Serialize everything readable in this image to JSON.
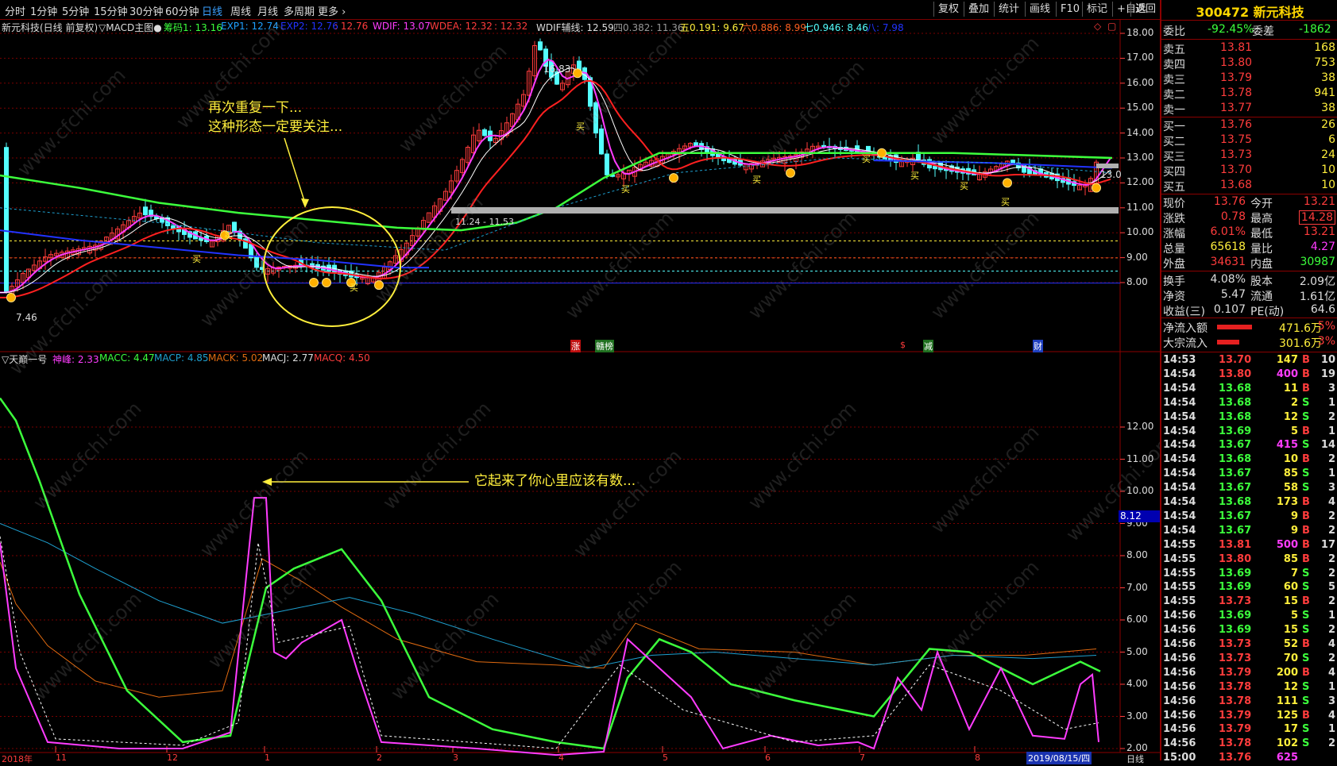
{
  "top_tabs": [
    "分时",
    "1分钟",
    "5分钟",
    "15分钟",
    "30分钟",
    "60分钟",
    "日线",
    "周线",
    "月线",
    "多周期",
    "更多"
  ],
  "active_tab": "日线",
  "toolbar_buttons": [
    "复权",
    "叠加",
    "统计",
    "画线",
    "F10",
    "标记",
    "+自选",
    "返回"
  ],
  "main_info": {
    "name": "新元科技(日线 前复权)",
    "indicator": "▽MACD主图●",
    "chouma": "筹码1: 13.16",
    "exp1": "EXP1: 12.74",
    "exp2": "EXP2: 12.76",
    "v1": ": 12.76",
    "wdif": "WDIF: 13.07",
    "wdea": "WDEA: 12.32",
    "v2": ": 12.32",
    "wdifaux": "WDIF辅线: 12.59",
    "s4": "四0.382: 11.36",
    "s5": "五0.191: 9.67",
    "s6": "六0.886: 8.99",
    "s7": "七0.946: 8.46",
    "s8": "八: 7.98"
  },
  "price_axis": [
    "18.00",
    "17.00",
    "16.00",
    "15.00",
    "14.00",
    "13.00",
    "12.00",
    "11.00",
    "10.00",
    "9.00",
    "8.00"
  ],
  "price_labels": {
    "low": "7.46",
    "high": "16.83",
    "range": "11.24 - 11.53",
    "right": "13.0"
  },
  "buy_marks": [
    "买",
    "买",
    "买",
    "买",
    "买",
    "买",
    "买",
    "买",
    "买",
    "买"
  ],
  "event_marks": [
    "涨",
    "赣榜",
    "$",
    "减",
    "财"
  ],
  "ann1": [
    "再次重复一下...",
    "这种形态一定要关注..."
  ],
  "ann2": "它起来了你心里应该有数...",
  "ind_info": {
    "name": "▽天巅一号",
    "shenfeng": "神峰: 2.33",
    "macc": "MACC: 4.47",
    "macp": "MACP: 4.85",
    "mack": "MACK: 5.02",
    "macj": "MACJ: 2.77",
    "macq": "MACQ: 4.50"
  },
  "ind_axis": [
    "12.00",
    "11.00",
    "10.00",
    "9.00",
    "8.00",
    "7.00",
    "6.00",
    "5.00",
    "4.00",
    "3.00",
    "2.00"
  ],
  "ind_current": "8.12",
  "x_axis": [
    "2018年",
    "11",
    "12",
    "1",
    "2",
    "3",
    "4",
    "5",
    "6",
    "7",
    "8"
  ],
  "x_date": "2019/08/15/四",
  "x_period": "日线",
  "watermark": "www.cfchi.com",
  "quote": {
    "code_name": "300472 新元科技",
    "weibi_label": "委比",
    "weibi": "-92.45%",
    "weicha_label": "委差",
    "weicha": "-1862",
    "sells": [
      {
        "l": "卖五",
        "p": "13.81",
        "v": "168"
      },
      {
        "l": "卖四",
        "p": "13.80",
        "v": "753"
      },
      {
        "l": "卖三",
        "p": "13.79",
        "v": "38"
      },
      {
        "l": "卖二",
        "p": "13.78",
        "v": "941"
      },
      {
        "l": "卖一",
        "p": "13.77",
        "v": "38"
      }
    ],
    "buys": [
      {
        "l": "买一",
        "p": "13.76",
        "v": "26"
      },
      {
        "l": "买二",
        "p": "13.75",
        "v": "6"
      },
      {
        "l": "买三",
        "p": "13.73",
        "v": "24"
      },
      {
        "l": "买四",
        "p": "13.70",
        "v": "10"
      },
      {
        "l": "买五",
        "p": "13.68",
        "v": "10"
      }
    ],
    "stats": [
      {
        "a": "现价",
        "av": "13.76",
        "b": "今开",
        "bv": "13.21"
      },
      {
        "a": "涨跌",
        "av": "0.78",
        "b": "最高",
        "bv": "14.28"
      },
      {
        "a": "涨幅",
        "av": "6.01%",
        "b": "最低",
        "bv": "13.21"
      },
      {
        "a": "总量",
        "av": "65618",
        "b": "量比",
        "bv": "4.27"
      },
      {
        "a": "外盘",
        "av": "34631",
        "b": "内盘",
        "bv": "30987"
      }
    ],
    "stats2": [
      {
        "a": "换手",
        "av": "4.08%",
        "b": "股本",
        "bv": "2.09亿"
      },
      {
        "a": "净资",
        "av": "5.47",
        "b": "流通",
        "bv": "1.61亿"
      },
      {
        "a": "收益(三)",
        "av": "0.107",
        "b": "PE(动)",
        "bv": "64.6"
      }
    ],
    "flows": [
      {
        "l": "净流入额",
        "v": "471.6万",
        "p": "5%",
        "fill": 0.55
      },
      {
        "l": "大宗流入",
        "v": "301.6万",
        "p": "3%",
        "fill": 0.35
      }
    ],
    "ticks": [
      {
        "t": "14:53",
        "p": "13.70",
        "v": "147",
        "s": "B",
        "n": "10"
      },
      {
        "t": "14:54",
        "p": "13.80",
        "v": "400",
        "s": "B",
        "n": "19"
      },
      {
        "t": "14:54",
        "p": "13.68",
        "v": "11",
        "s": "B",
        "n": "3"
      },
      {
        "t": "14:54",
        "p": "13.68",
        "v": "2",
        "s": "S",
        "n": "1"
      },
      {
        "t": "14:54",
        "p": "13.68",
        "v": "12",
        "s": "S",
        "n": "2"
      },
      {
        "t": "14:54",
        "p": "13.69",
        "v": "5",
        "s": "B",
        "n": "1"
      },
      {
        "t": "14:54",
        "p": "13.67",
        "v": "415",
        "s": "S",
        "n": "14"
      },
      {
        "t": "14:54",
        "p": "13.68",
        "v": "10",
        "s": "B",
        "n": "2"
      },
      {
        "t": "14:54",
        "p": "13.67",
        "v": "85",
        "s": "S",
        "n": "1"
      },
      {
        "t": "14:54",
        "p": "13.67",
        "v": "58",
        "s": "S",
        "n": "3"
      },
      {
        "t": "14:54",
        "p": "13.68",
        "v": "173",
        "s": "B",
        "n": "4"
      },
      {
        "t": "14:54",
        "p": "13.67",
        "v": "9",
        "s": "B",
        "n": "2"
      },
      {
        "t": "14:54",
        "p": "13.67",
        "v": "9",
        "s": "B",
        "n": "2"
      },
      {
        "t": "14:55",
        "p": "13.81",
        "v": "500",
        "s": "B",
        "n": "17"
      },
      {
        "t": "14:55",
        "p": "13.80",
        "v": "85",
        "s": "B",
        "n": "2"
      },
      {
        "t": "14:55",
        "p": "13.69",
        "v": "7",
        "s": "S",
        "n": "2"
      },
      {
        "t": "14:55",
        "p": "13.69",
        "v": "60",
        "s": "S",
        "n": "5"
      },
      {
        "t": "14:55",
        "p": "13.73",
        "v": "15",
        "s": "B",
        "n": "2"
      },
      {
        "t": "14:56",
        "p": "13.69",
        "v": "5",
        "s": "S",
        "n": "1"
      },
      {
        "t": "14:56",
        "p": "13.69",
        "v": "15",
        "s": "S",
        "n": "2"
      },
      {
        "t": "14:56",
        "p": "13.73",
        "v": "52",
        "s": "B",
        "n": "4"
      },
      {
        "t": "14:56",
        "p": "13.73",
        "v": "70",
        "s": "S",
        "n": "2"
      },
      {
        "t": "14:56",
        "p": "13.79",
        "v": "200",
        "s": "B",
        "n": "4"
      },
      {
        "t": "14:56",
        "p": "13.78",
        "v": "12",
        "s": "S",
        "n": "1"
      },
      {
        "t": "14:56",
        "p": "13.78",
        "v": "111",
        "s": "S",
        "n": "3"
      },
      {
        "t": "14:56",
        "p": "13.79",
        "v": "125",
        "s": "B",
        "n": "4"
      },
      {
        "t": "14:56",
        "p": "13.79",
        "v": "17",
        "s": "S",
        "n": "1"
      },
      {
        "t": "14:56",
        "p": "13.78",
        "v": "102",
        "s": "S",
        "n": "2"
      },
      {
        "t": "15:00",
        "p": "13.76",
        "v": "625",
        "s": "",
        "n": ""
      }
    ]
  },
  "colors": {
    "up": "#ff3c3c",
    "down": "#54ffff",
    "yellow": "#ffef3c",
    "green": "#3cff3c",
    "magenta": "#ff3cff",
    "blue": "#1a33ff",
    "orange": "#e06a10",
    "cyan": "#1ea0d0"
  }
}
